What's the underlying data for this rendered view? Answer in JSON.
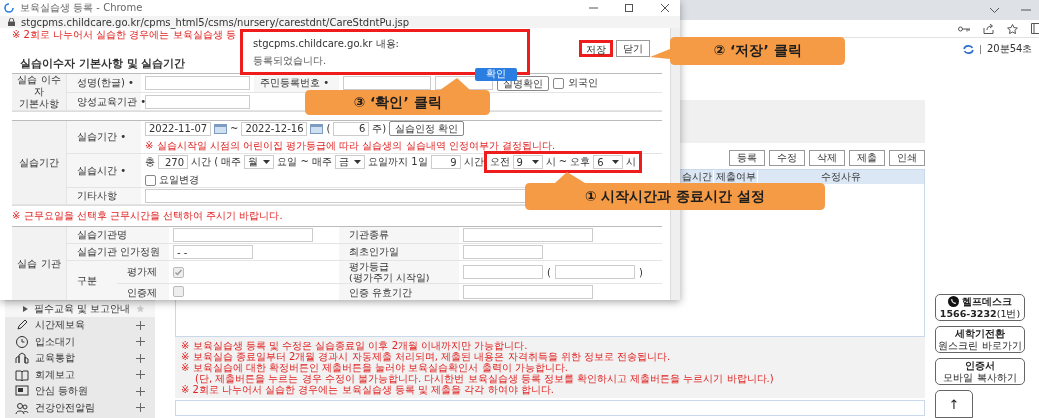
{
  "main_page": {
    "timer": "20분54초",
    "buttons": [
      "등록",
      "수정",
      "삭제",
      "제출",
      "인쇄"
    ],
    "table_columns": [
      "습시간",
      "제출여부",
      "수정사유"
    ],
    "notices": [
      {
        "kind": "bullet",
        "text": "※ 보육실습생 등록 및 수정은 실습종료일 이후 2개월 이내까지만 가능합니다."
      },
      {
        "kind": "bullet",
        "text": "※ 보육실습 종료일부터 2개월 경과시 자동제출 처리되며, 제출된 내용은 자격취득을 위한 정보로 전송됩니다."
      },
      {
        "kind": "bullet",
        "text": "※ 보육실습에 대한 확정버튼인 제출버튼을 눌러야 보육실습확인서 출력이 가능합니다."
      },
      {
        "kind": "continuation",
        "text": "(단, 제출버튼을 누르는 경우 수정이 불가능합니다. 다시한번 보육실습생 등록 정보를 확인하시고 제출버튼을 누르시기 바랍니다.)"
      },
      {
        "kind": "bullet",
        "text": "※ 2회로 나누어서 실습한 경우에는 보육실습생 등록 및 제출을 각각 하여야 합니다."
      }
    ],
    "sidebar": [
      {
        "label": "필수교육 및 보고안내",
        "kind": "submenu"
      },
      {
        "label": "시간제보육",
        "kind": "menu"
      },
      {
        "label": "입소대기",
        "kind": "menu"
      },
      {
        "label": "교육통합",
        "kind": "menu"
      },
      {
        "label": "회계보고",
        "kind": "menu"
      },
      {
        "label": "안심 등하원",
        "kind": "menu"
      },
      {
        "label": "건강안전알림",
        "kind": "menu"
      }
    ],
    "side_buttons": [
      {
        "kind": "phone",
        "title": "헬프데스크",
        "subtitle": "**1566-3232**(1번)"
      },
      {
        "kind": "plain",
        "title": "세학기전환",
        "subtitle": "원스크린 바로가기"
      },
      {
        "kind": "plain",
        "title": "인증서",
        "subtitle": "모바일 복사하기"
      }
    ],
    "top_button": "↑"
  },
  "popup_window": {
    "title": "보육실습생 등록 - Chrome",
    "url": "stgcpms.childcare.go.kr/cpms_html5/csms/nursery/carestdnt/CareStdntPu.jsp",
    "top_notice": "※ 2회로 나누어서 실습한 경우에는 보육실습생 등",
    "buttons": [
      {
        "label": "저장",
        "highlighted": true
      },
      {
        "label": "닫기",
        "highlighted": false
      }
    ],
    "section_title": "실습이수자 기본사항 및 실습기간",
    "trainee": {
      "group_lines": [
        "실습 이수자",
        "기본사항"
      ],
      "name_label": "성명(한글) •",
      "id_label": "주민등록번호 •",
      "verify_button": "실명확인",
      "foreigner": {
        "label": "외국인",
        "checked": false
      },
      "school_label": "양성교육기관 •"
    },
    "period": {
      "group": "실습기간",
      "period_label": "실습기간 •",
      "start_date": "2022-11-07",
      "date_separator": "~",
      "end_date": "2022-12-16",
      "weeks_open": "(",
      "weeks": "6",
      "weeks_unit": "주)",
      "confirm_button": "실습인정 확인",
      "period_note": "※ 실습시작일 시점의 어린이집 평가등급에 따라 실습생의 실습내역 인정여부가 결정됩니다.",
      "hours_label": "실습시간 •",
      "schedule": [
        {
          "kind": "text",
          "text": "총"
        },
        {
          "kind": "input",
          "value": "270"
        },
        {
          "kind": "text",
          "text": "시간 ( 매주"
        },
        {
          "kind": "select",
          "value": "월"
        },
        {
          "kind": "text",
          "text": "요일 ~ 매주"
        },
        {
          "kind": "select",
          "value": "금"
        },
        {
          "kind": "text",
          "text": "요일까지 1일"
        },
        {
          "kind": "input",
          "value": "9"
        },
        {
          "kind": "text",
          "text": "시간"
        }
      ],
      "time_range": {
        "highlighted": true,
        "parts": [
          {
            "kind": "text",
            "text": "오전"
          },
          {
            "kind": "select",
            "value": "9"
          },
          {
            "kind": "text",
            "text": "시 ~ 오후"
          },
          {
            "kind": "select",
            "value": "6"
          },
          {
            "kind": "text",
            "text": "시"
          }
        ]
      },
      "day_change": {
        "label": "요일변경",
        "checked": false
      },
      "other_label": "기타사항"
    },
    "work_note": "※ 근무요일을 선택후 근무시간을 선택하여 주시기 바랍니다.",
    "institution": {
      "group": "실습 기관",
      "name_label": "실습기관명",
      "type_label": "기관종류",
      "capacity_label": "실습기관 인가정원",
      "capacity_value": "- -",
      "first_approval_label": "최초인가일",
      "category_label": "구분",
      "evaluation": {
        "label": "평가제",
        "checked": true,
        "disabled": true
      },
      "grade_label_lines": [
        "평가등급",
        "(평가주기 시작일)"
      ],
      "grade_open": "(",
      "grade_close": ")",
      "certification": {
        "label": "인증제",
        "checked": false,
        "disabled": true
      },
      "validity_label": "인증 유효기간"
    }
  },
  "alert": {
    "origin": "stgcpms.childcare.go.kr 내용:",
    "message": "등록되었습니다.",
    "button": "확인",
    "highlighted": true
  },
  "callouts": [
    {
      "text": "③ ‘확인’ 클릭"
    },
    {
      "text": "② ‘저장’ 클릭"
    },
    {
      "text": "① 시작시간과 종료시간 설정"
    }
  ]
}
